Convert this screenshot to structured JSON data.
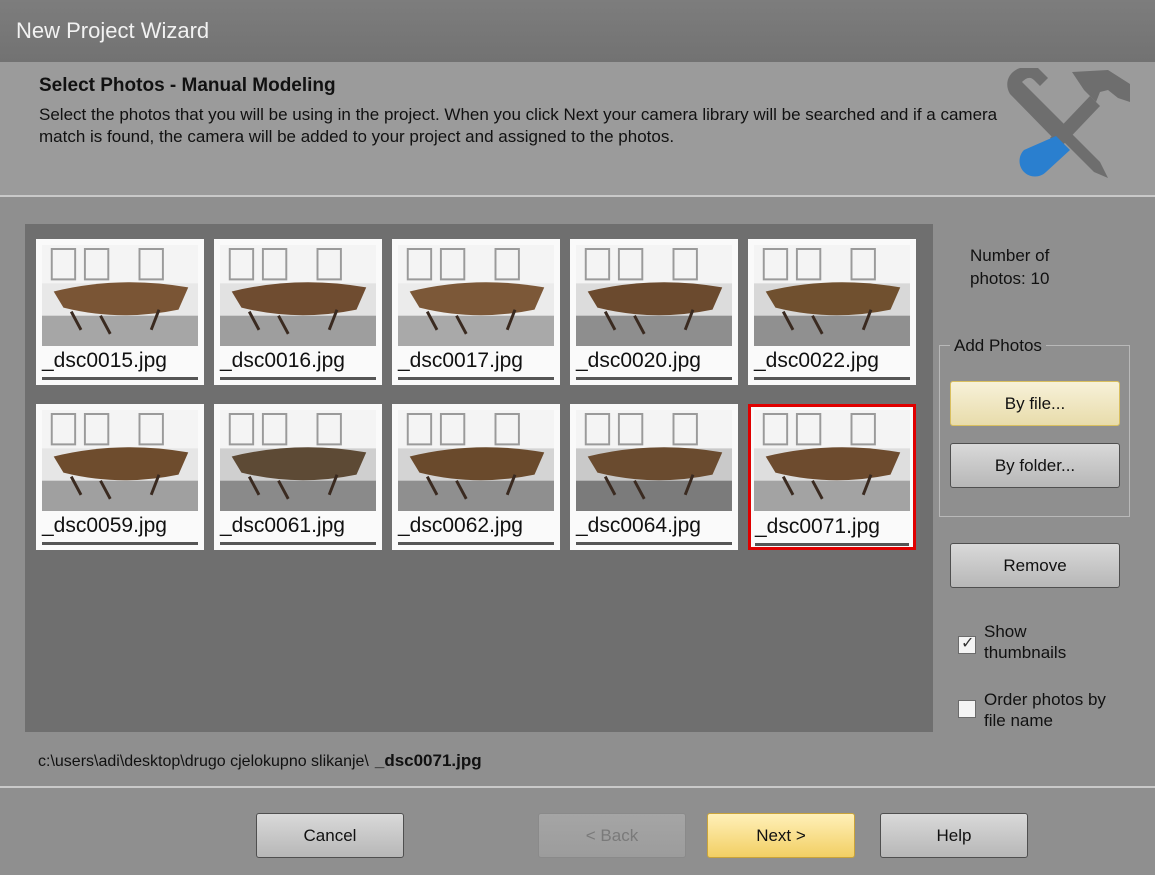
{
  "window": {
    "title": "New Project Wizard"
  },
  "header": {
    "title": "Select Photos - Manual Modeling",
    "description": "Select the photos that you will be using in the project. When you click Next your camera library will be searched and if a camera match is found, the camera will be added to your project and assigned to the photos."
  },
  "photos": [
    {
      "name": "_dsc0015.jpg",
      "selected": false
    },
    {
      "name": "_dsc0016.jpg",
      "selected": false
    },
    {
      "name": "_dsc0017.jpg",
      "selected": false
    },
    {
      "name": "_dsc0020.jpg",
      "selected": false
    },
    {
      "name": "_dsc0022.jpg",
      "selected": false
    },
    {
      "name": "_dsc0059.jpg",
      "selected": false
    },
    {
      "name": "_dsc0061.jpg",
      "selected": false
    },
    {
      "name": "_dsc0062.jpg",
      "selected": false
    },
    {
      "name": "_dsc0064.jpg",
      "selected": false
    },
    {
      "name": "_dsc0071.jpg",
      "selected": true
    }
  ],
  "path": {
    "folder": "c:\\users\\adi\\desktop\\drugo cjelokupno slikanje\\",
    "file": "_dsc0071.jpg"
  },
  "side": {
    "count_label": "Number of photos: 10",
    "add_photos_group": "Add Photos",
    "by_file": "By file...",
    "by_folder": "By folder...",
    "remove": "Remove",
    "show_thumbnails": {
      "label": "Show thumbnails",
      "checked": true
    },
    "order_by_name": {
      "label": "Order photos by file name",
      "checked": false
    }
  },
  "footer": {
    "cancel": "Cancel",
    "back": "< Back",
    "next": "Next >",
    "help": "Help"
  },
  "colors": {
    "selection": "#e00000",
    "accent": "#f2cf64"
  }
}
